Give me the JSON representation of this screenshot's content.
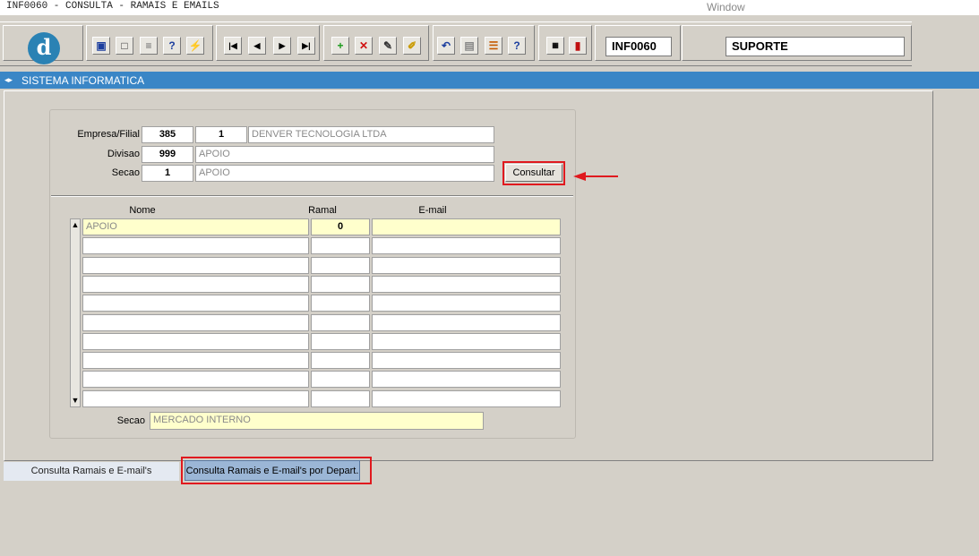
{
  "window": {
    "title": "INF0060 - CONSULTA - RAMAIS E EMAILS",
    "menu": "Window"
  },
  "toolbar": {
    "logo_letter": "d",
    "form_code": "INF0060",
    "user": "SUPORTE",
    "icons": [
      "save-icon",
      "print-preview-icon",
      "print-icon",
      "query-icon",
      "execute-query-icon",
      "first-record-icon",
      "previous-record-icon",
      "next-record-icon",
      "last-record-icon",
      "insert-record-icon",
      "delete-record-icon",
      "edit-record-icon",
      "clear-record-icon",
      "undo-icon",
      "clipboard-icon",
      "list-icon",
      "help-icon",
      "menu-icon",
      "exit-icon"
    ]
  },
  "section": {
    "title": "SISTEMA INFORMATICA"
  },
  "form": {
    "empresa_label": "Empresa/Filial",
    "empresa": "385",
    "filial": "1",
    "empresa_nome": "DENVER TECNOLOGIA LTDA",
    "divisao_label": "Divisao",
    "divisao": "999",
    "divisao_nome": "APOIO",
    "secao_label": "Secao",
    "secao": "1",
    "secao_nome": "APOIO",
    "consultar_label": "Consultar"
  },
  "grid": {
    "columns": [
      "Nome",
      "Ramal",
      "E-mail"
    ],
    "rows": [
      {
        "nome": "APOIO",
        "ramal": "0",
        "email": ""
      },
      {
        "nome": "",
        "ramal": "",
        "email": ""
      },
      {
        "nome": "",
        "ramal": "",
        "email": ""
      },
      {
        "nome": "",
        "ramal": "",
        "email": ""
      },
      {
        "nome": "",
        "ramal": "",
        "email": ""
      },
      {
        "nome": "",
        "ramal": "",
        "email": ""
      },
      {
        "nome": "",
        "ramal": "",
        "email": ""
      },
      {
        "nome": "",
        "ramal": "",
        "email": ""
      },
      {
        "nome": "",
        "ramal": "",
        "email": ""
      },
      {
        "nome": "",
        "ramal": "",
        "email": ""
      }
    ],
    "secao_label": "Secao",
    "secao_value": "MERCADO INTERNO"
  },
  "tabs": [
    {
      "label": "Consulta Ramais e E-mail's"
    },
    {
      "label": "Consulta Ramais e E-mail's por Depart."
    }
  ],
  "colors": {
    "section_header": "#3a86c6",
    "highlight": "#e0191e",
    "current_row": "#ffffcc"
  }
}
